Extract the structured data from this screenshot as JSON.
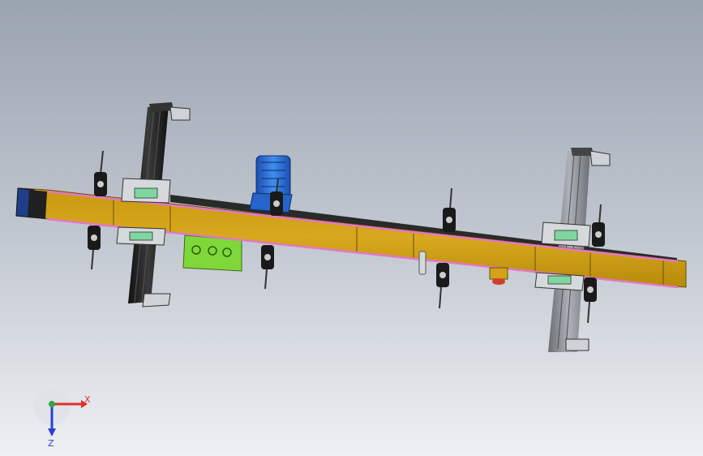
{
  "triad": {
    "x_label": "X",
    "z_label": "Z",
    "x_color": "#e0302a",
    "y_color": "#2ea84a",
    "z_color": "#2b3fd6"
  },
  "colors": {
    "beam": "#d2a218",
    "beam_edge": "#7a5c05",
    "belt_stripe": "#e377c7",
    "rail": "#1c1c1c",
    "motor": "#2f7de0",
    "junction_box": "#7fd83a",
    "carriage": "#d6d9dc",
    "background_top": "#9aa3b0",
    "background_bottom": "#eef0f3"
  },
  "icons": {
    "triad": "coordinate-triad-icon"
  }
}
